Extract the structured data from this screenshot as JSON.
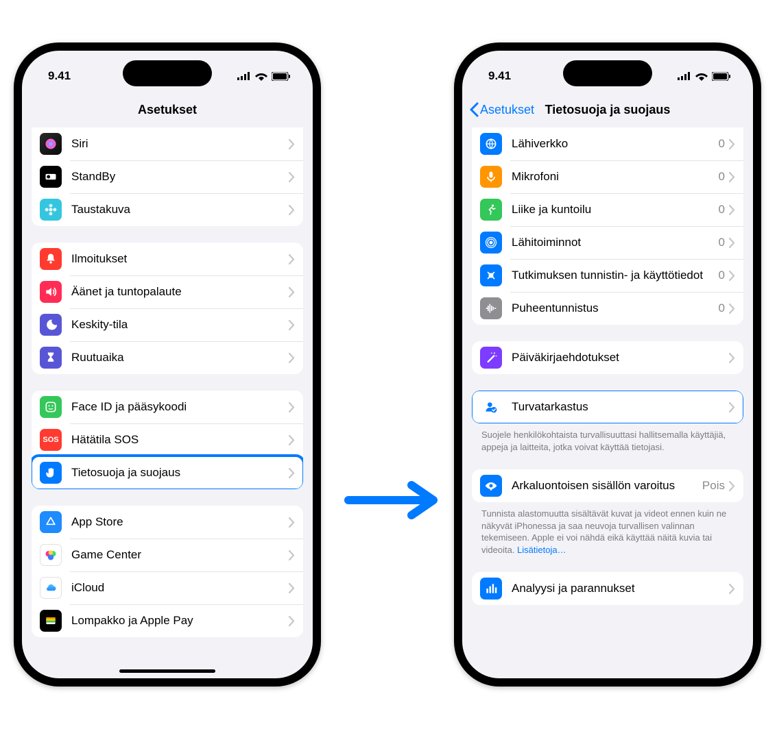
{
  "status": {
    "time": "9.41"
  },
  "left": {
    "title": "Asetukset",
    "groups": [
      {
        "first_cut": true,
        "rows": [
          {
            "icon": "siri-icon",
            "bg": "linear-gradient(135deg,#2a2a2a,#0a0a0a)",
            "glyph": "siri",
            "label": "Siri"
          },
          {
            "icon": "standby-icon",
            "bg": "#000000",
            "glyph": "clock",
            "label": "StandBy"
          },
          {
            "icon": "wallpaper-icon",
            "bg": "#35c6df",
            "glyph": "flower",
            "label": "Taustakuva"
          }
        ]
      },
      {
        "rows": [
          {
            "icon": "notifications-icon",
            "bg": "#ff3b30",
            "glyph": "bell",
            "label": "Ilmoitukset"
          },
          {
            "icon": "sounds-icon",
            "bg": "#ff2d55",
            "glyph": "sound",
            "label": "Äänet ja tuntopalaute"
          },
          {
            "icon": "focus-icon",
            "bg": "#5856d6",
            "glyph": "moon",
            "label": "Keskity-tila"
          },
          {
            "icon": "screentime-icon",
            "bg": "#5856d6",
            "glyph": "hourglass",
            "label": "Ruutuaika"
          }
        ]
      },
      {
        "rows": [
          {
            "icon": "faceid-icon",
            "bg": "#34c759",
            "glyph": "face",
            "label": "Face ID ja pääsykoodi"
          },
          {
            "icon": "sos-icon",
            "bg": "#ff3b30",
            "glyph": "sos",
            "label": "Hätätila SOS"
          },
          {
            "icon": "privacy-icon",
            "bg": "#007aff",
            "glyph": "hand",
            "label": "Tietosuoja ja suojaus",
            "highlighted": true
          }
        ]
      },
      {
        "rows": [
          {
            "icon": "appstore-icon",
            "bg": "#1e8bff",
            "glyph": "appstore",
            "label": "App Store"
          },
          {
            "icon": "gamecenter-icon",
            "bg": "#ffffff",
            "glyph": "gamecenter",
            "label": "Game Center"
          },
          {
            "icon": "icloud-icon",
            "bg": "#ffffff",
            "glyph": "icloud",
            "label": "iCloud"
          },
          {
            "icon": "wallet-icon",
            "bg": "#000000",
            "glyph": "wallet",
            "label": "Lompakko ja Apple Pay"
          }
        ]
      }
    ]
  },
  "right": {
    "back": "Asetukset",
    "title": "Tietosuoja ja suojaus",
    "groups": [
      {
        "first_cut": true,
        "rows": [
          {
            "icon": "local-network-icon",
            "bg": "#007aff",
            "glyph": "globe",
            "label": "Lähiverkko",
            "value": "0"
          },
          {
            "icon": "microphone-icon",
            "bg": "#ff9500",
            "glyph": "mic",
            "label": "Mikrofoni",
            "value": "0"
          },
          {
            "icon": "motion-icon",
            "bg": "#34c759",
            "glyph": "runner",
            "label": "Liike ja kuntoilu",
            "value": "0"
          },
          {
            "icon": "nearby-icon",
            "bg": "#007aff",
            "glyph": "radar",
            "label": "Lähitoiminnot",
            "value": "0"
          },
          {
            "icon": "research-icon",
            "bg": "#007aff",
            "glyph": "sensor",
            "label": "Tutkimuksen tunnistin- ja käyttötiedot",
            "value": "0"
          },
          {
            "icon": "speech-icon",
            "bg": "#8e8e93",
            "glyph": "wave",
            "label": "Puheentunnistus",
            "value": "0"
          }
        ]
      },
      {
        "rows": [
          {
            "icon": "journal-icon",
            "bg": "#7d3cff",
            "glyph": "wand",
            "label": "Päiväkirjaehdotukset"
          }
        ]
      },
      {
        "rows": [
          {
            "icon": "safetycheck-icon",
            "bg": "#ffffff",
            "glyph": "personcheck",
            "label": "Turvatarkastus",
            "highlighted": true,
            "plain_icon": true
          }
        ],
        "footer": "Suojele henkilökohtaista turvallisuuttasi hallitsemalla käyttäjiä, appeja ja laitteita, jotka voivat käyttää tietojasi."
      },
      {
        "rows": [
          {
            "icon": "sensitive-icon",
            "bg": "#007aff",
            "glyph": "eye",
            "label": "Arkaluontoisen sisällön varoitus",
            "value": "Pois"
          }
        ],
        "footer": "Tunnista alastomuutta sisältävät kuvat ja videot ennen kuin ne näkyvät iPhonessa ja saa neuvoja turvallisen valinnan tekemiseen. Apple ei voi nähdä eikä käyttää näitä kuvia tai videoita.",
        "footer_link": "Lisätietoja…"
      },
      {
        "rows": [
          {
            "icon": "analytics-icon",
            "bg": "#007aff",
            "glyph": "bars",
            "label": "Analyysi ja parannukset"
          }
        ]
      }
    ]
  }
}
